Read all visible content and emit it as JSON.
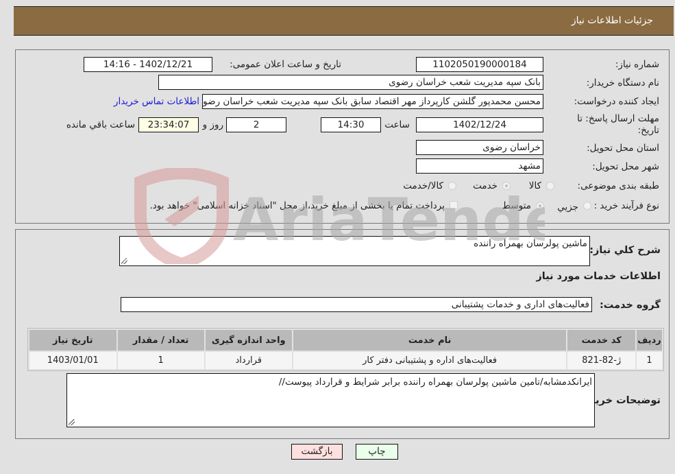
{
  "header": {
    "title": "جزئیات اطلاعات نیاز"
  },
  "details": {
    "need_number_label": "شماره نیاز:",
    "need_number": "1102050190000184",
    "announce_label": "تاریخ و ساعت اعلان عمومی:",
    "announce_value": "1402/12/21 - 14:16",
    "buyer_org_label": "نام دستگاه خریدار:",
    "buyer_org": "بانک سپه مدیریت شعب خراسان رضوی",
    "creator_label": "ایجاد کننده درخواست:",
    "creator": "محسن محمدپور گلشن کارپرداز مهر اقتصاد سابق بانک سپه مدیریت شعب خراسان رضوی",
    "contact_link": "اطلاعات تماس خریدار",
    "deadline_label": "مهلت ارسال پاسخ: تا تاریخ:",
    "deadline_date": "1402/12/24",
    "time_label": "ساعت",
    "deadline_time": "14:30",
    "days_value": "2",
    "days_label": "روز و",
    "remaining_time": "23:34:07",
    "remaining_label": "ساعت باقي مانده",
    "province_label": "استان محل تحویل:",
    "province": "خراسان رضوی",
    "city_label": "شهر محل تحویل:",
    "city": "مشهد",
    "category_label": "طبقه بندی موضوعی:",
    "category_options": [
      {
        "label": "کالا",
        "selected": false
      },
      {
        "label": "خدمت",
        "selected": true
      },
      {
        "label": "کالا/خدمت",
        "selected": false
      }
    ],
    "process_label": "نوع فرآیند خرید :",
    "process_options": [
      {
        "label": "جزيي",
        "selected": false
      },
      {
        "label": "متوسط",
        "selected": true
      }
    ],
    "treasury_note": "پرداخت تمام یا بخشی از مبلغ خرید،از محل \"اسناد خزانه اسلامی\" خواهد بود."
  },
  "services": {
    "summary_label": "شرح کلي نیاز:",
    "summary": "ماشین پولرسان بهمراه راننده",
    "section_title": "اطلاعات خدمات مورد نیاز",
    "group_label": "گروه خدمت:",
    "group": "فعالیت‌های اداری و خدمات پشتیبانی",
    "table": {
      "headers": [
        "ردیف",
        "کد خدمت",
        "نام خدمت",
        "واحد اندازه گیری",
        "تعداد / مقدار",
        "تاریخ نیاز"
      ],
      "rows": [
        [
          "1",
          "ژ-82-821",
          "فعالیت‌های اداره و پشتیبانی دفتر کار",
          "قرارداد",
          "1",
          "1403/01/01"
        ]
      ]
    },
    "buyer_notes_label": "توضیحات خریدار:",
    "buyer_notes": "ایرانکدمشابه/تامین ماشین پولرسان بهمراه راننده برابر شرایط و قرارداد پیوست//"
  },
  "buttons": {
    "print": "چاپ",
    "back": "بازگشت"
  },
  "watermark": "AriaTender.neT",
  "colors": {
    "header_bg": "#8b6b41",
    "back_btn": "#ffe0e0",
    "print_btn": "#eaffea",
    "link": "#1a1ad8"
  }
}
